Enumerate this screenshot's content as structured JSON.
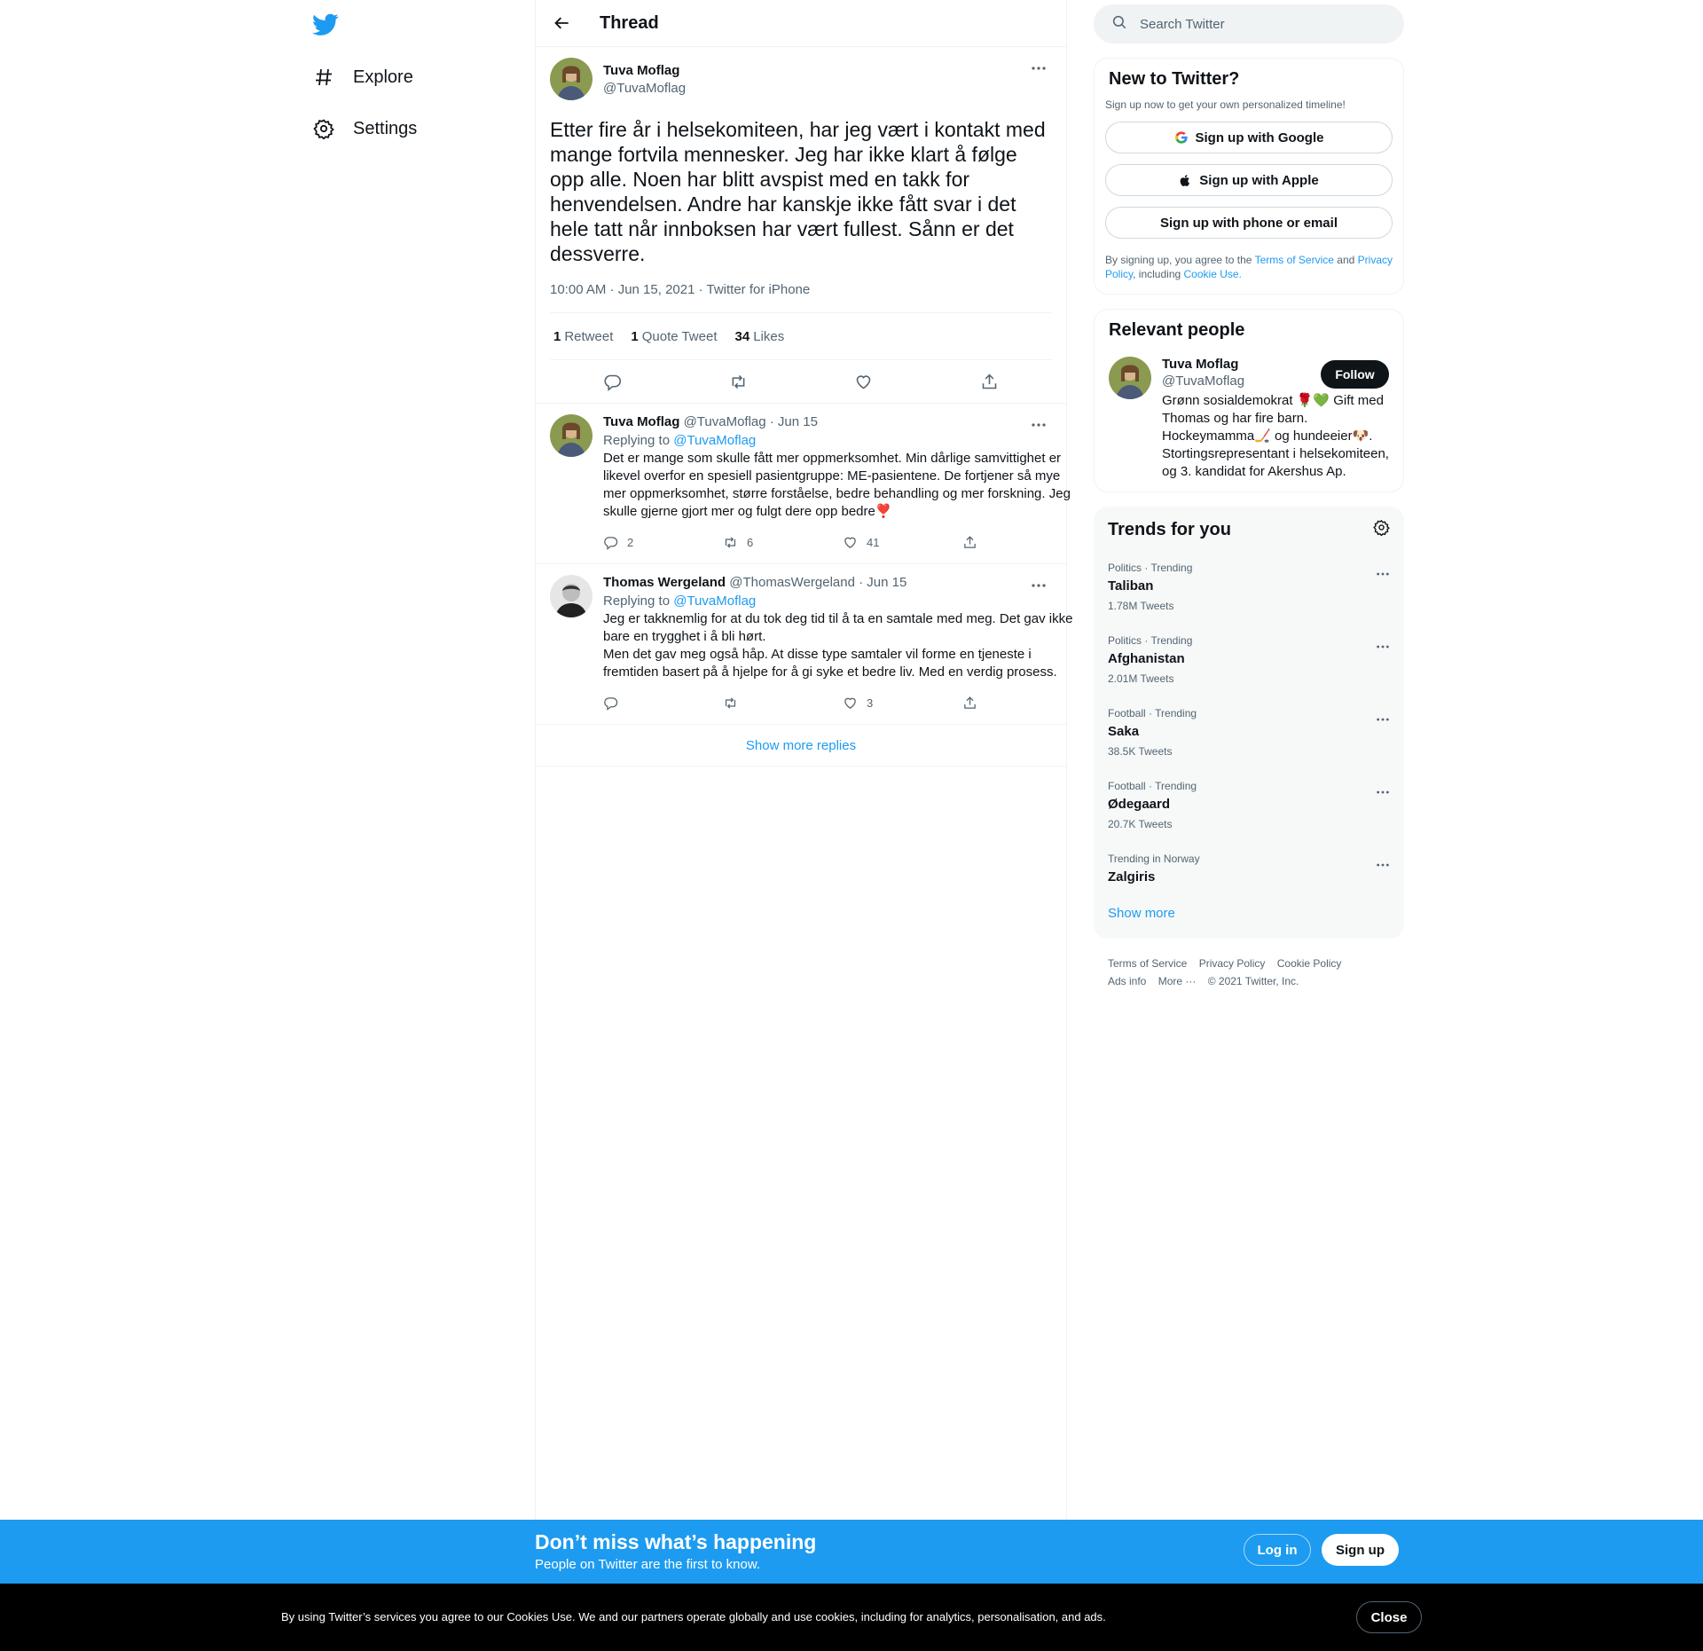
{
  "nav": {
    "explore_label": "Explore",
    "settings_label": "Settings"
  },
  "header": {
    "title": "Thread"
  },
  "tweet": {
    "name": "Tuva Moflag",
    "handle": "@TuvaMoflag",
    "text": "Etter fire år i helsekomiteen, har jeg vært i kontakt med mange fortvila mennesker. Jeg har ikke klart å følge opp alle. Noen har blitt avspist med en takk for henvendelsen. Andre har kanskje ikke fått svar i det hele tatt når innboksen har vært fullest. Sånn er det dessverre.",
    "meta": "10:00 AM · Jun 15, 2021 · Twitter for iPhone",
    "retweets_count": "1",
    "retweets_label": "Retweet",
    "quotes_count": "1",
    "quotes_label": "Quote Tweet",
    "likes_count": "34",
    "likes_label": "Likes"
  },
  "replies": [
    {
      "name": "Tuva Moflag",
      "handle_date": "@TuvaMoflag · Jun 15",
      "replying_prefix": "Replying to",
      "replying_to": "@TuvaMoflag",
      "text": "Det er mange som skulle fått mer oppmerksomhet. Min dårlige samvittighet er likevel overfor en spesiell pasientgruppe: ME-pasientene. De fortjener så mye mer oppmerksomhet, større forståelse, bedre behandling og mer forskning. Jeg skulle gjerne gjort mer og fulgt dere opp bedre❣️",
      "replies": "2",
      "retweets": "6",
      "likes": "41"
    },
    {
      "name": "Thomas Wergeland",
      "handle_date": "@ThomasWergeland · Jun 15",
      "replying_prefix": "Replying to",
      "replying_to": "@TuvaMoflag",
      "text": "Jeg er takknemlig for at du tok deg tid til å ta en samtale med meg. Det gav ikke bare en trygghet i å bli hørt.\nMen det gav meg også håp.  At disse type samtaler vil forme en tjeneste i fremtiden basert på å hjelpe for å gi syke et bedre liv. Med en verdig prosess.",
      "replies": "",
      "retweets": "",
      "likes": "3"
    }
  ],
  "show_more_replies": "Show more replies",
  "search": {
    "placeholder": "Search Twitter"
  },
  "new_to_twitter": {
    "title": "New to Twitter?",
    "subtitle": "Sign up now to get your own personalized timeline!",
    "google": "Sign up with Google",
    "apple": "Sign up with Apple",
    "phone": "Sign up with phone or email",
    "legal_1": "By signing up, you agree to the",
    "terms": "Terms of Service",
    "legal_2": "and",
    "privacy": "Privacy Policy",
    "legal_3": ", including",
    "cookie": "Cookie Use."
  },
  "relevant_people": {
    "title": "Relevant people",
    "name": "Tuva Moflag",
    "handle": "@TuvaMoflag",
    "follow": "Follow",
    "bio": "Grønn sosialdemokrat 🌹💚 Gift med Thomas og har fire barn. Hockeymamma🏒 og hundeeier🐶. Stortingsrepresentant i helsekomiteen, og 3. kandidat for Akershus Ap."
  },
  "trends": {
    "title": "Trends for you",
    "items": [
      {
        "context": "Politics · Trending",
        "name": "Taliban",
        "count": "1.78M Tweets"
      },
      {
        "context": "Politics · Trending",
        "name": "Afghanistan",
        "count": "2.01M Tweets"
      },
      {
        "context": "Football · Trending",
        "name": "Saka",
        "count": "38.5K Tweets"
      },
      {
        "context": "Football · Trending",
        "name": "Ødegaard",
        "count": "20.7K Tweets"
      },
      {
        "context": "Trending in Norway",
        "name": "Zalgiris",
        "count": ""
      }
    ],
    "show_more": "Show more"
  },
  "footer": {
    "terms": "Terms of Service",
    "privacy": "Privacy Policy",
    "cookie": "Cookie Policy",
    "ads": "Ads info",
    "more": "More ···",
    "copyright": "© 2021 Twitter, Inc."
  },
  "bottom_bar": {
    "title": "Don’t miss what’s happening",
    "subtitle": "People on Twitter are the first to know.",
    "login": "Log in",
    "signup": "Sign up"
  },
  "cookie_bar": {
    "text": "By using Twitter’s services you agree to our Cookies Use. We and our partners operate globally and use cookies, including for analytics, personalisation, and ads.",
    "close": "Close"
  },
  "colors": {
    "brand": "#1d9bf0",
    "text": "#0f1419",
    "muted": "#536471",
    "border": "#eff3f4"
  }
}
